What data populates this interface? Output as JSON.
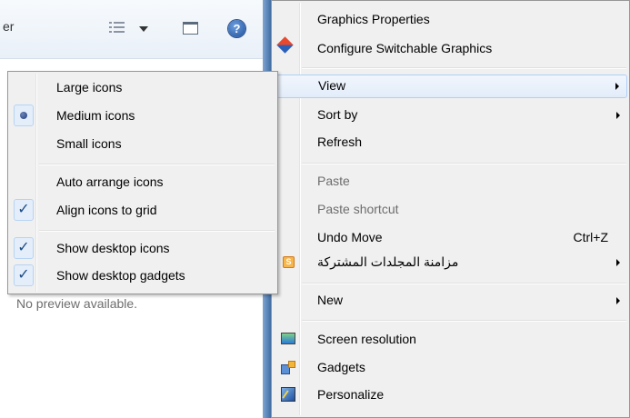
{
  "explorer": {
    "title_fragment": "er",
    "help_glyph": "?",
    "preview_text": "No preview available."
  },
  "main_menu": {
    "graphics_properties": "Graphics Properties",
    "configure_graphics": "Configure Switchable Graphics",
    "view": "View",
    "sort_by": "Sort by",
    "refresh": "Refresh",
    "paste": "Paste",
    "paste_shortcut": "Paste shortcut",
    "undo_move": "Undo Move",
    "undo_shortcut": "Ctrl+Z",
    "sync_folders": "مزامنة المجلدات المشتركة",
    "sync_icon_glyph": "S",
    "new": "New",
    "screen_resolution": "Screen resolution",
    "gadgets": "Gadgets",
    "personalize": "Personalize"
  },
  "view_submenu": {
    "large_icons": "Large icons",
    "medium_icons": "Medium icons",
    "small_icons": "Small icons",
    "auto_arrange": "Auto arrange icons",
    "align_to_grid": "Align icons to grid",
    "show_desktop_icons": "Show desktop icons",
    "show_gadgets": "Show desktop gadgets",
    "check_glyph": "✓",
    "selected_size": "Medium icons",
    "auto_arrange_checked": false,
    "align_to_grid_checked": true,
    "show_desktop_icons_checked": true,
    "show_gadgets_checked": true
  }
}
